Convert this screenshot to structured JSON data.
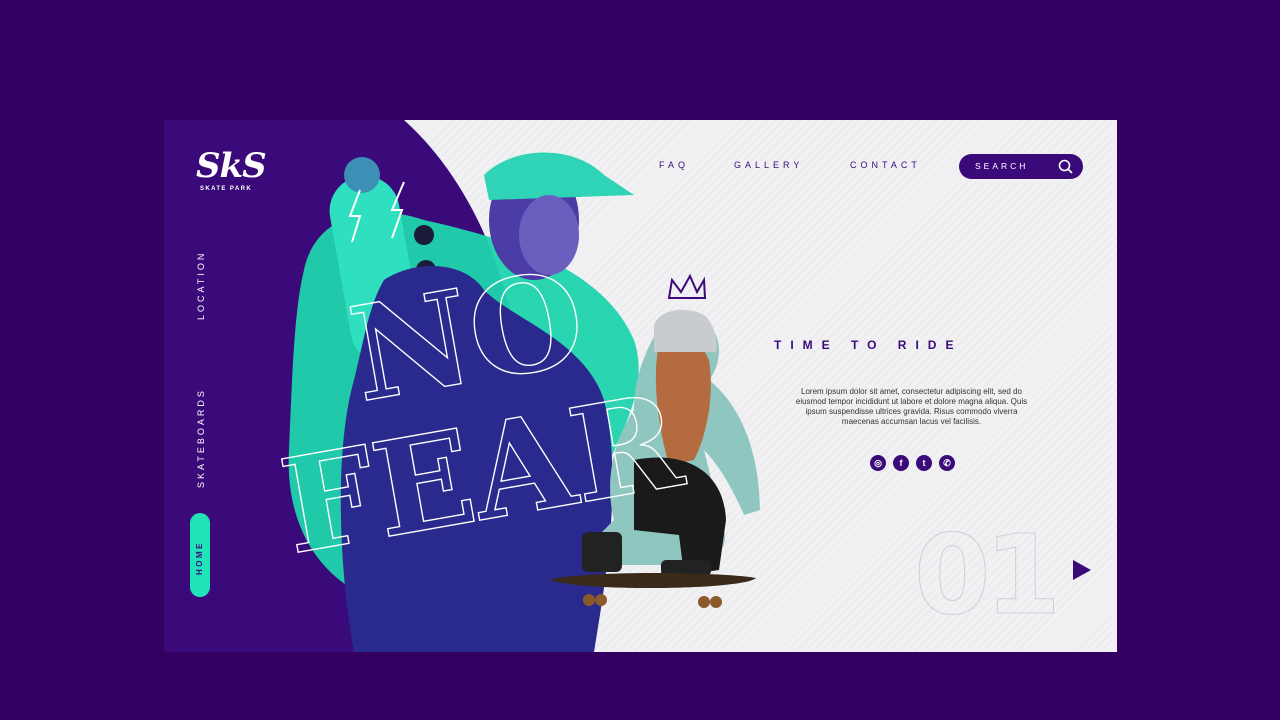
{
  "brand": {
    "mark": "SkS",
    "subtitle": "SKATE PARK"
  },
  "side_nav": {
    "location": "LOCATION",
    "skateboards": "SKATEBOARDS",
    "home": "HOME"
  },
  "top_nav": {
    "faq": "FAQ",
    "gallery": "GALLERY",
    "contact": "CONTACT",
    "search": "SEARCH"
  },
  "hero": {
    "word1": "NO",
    "word2": "FEAR",
    "tagline": "TIME TO RIDE",
    "description": "Lorem ipsum dolor sit amet, consectetur adipiscing elit, sed do eiusmod tempor incididunt ut labore et dolore magna aliqua. Quis ipsum suspendisse ultrices gravida. Risus commodo viverra maecenas accumsan lacus vel facilisis."
  },
  "socials": [
    {
      "name": "instagram-icon",
      "glyph": "◎"
    },
    {
      "name": "facebook-icon",
      "glyph": "f"
    },
    {
      "name": "twitter-icon",
      "glyph": "t"
    },
    {
      "name": "whatsapp-icon",
      "glyph": "✆"
    }
  ],
  "slide": {
    "number": "01"
  },
  "colors": {
    "background": "#330062",
    "purple": "#3a0a7a",
    "accent": "#20e4b8",
    "panel": "#f1f1f3"
  }
}
